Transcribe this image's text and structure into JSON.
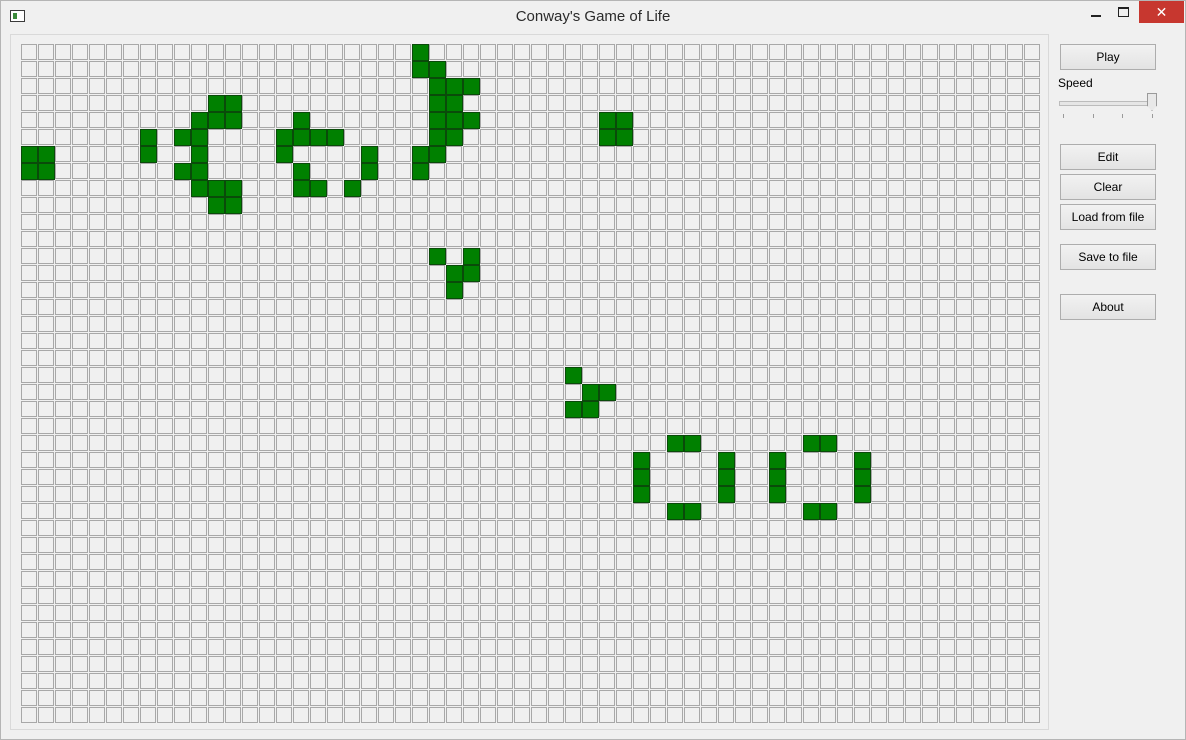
{
  "window": {
    "title": "Conway's Game of Life",
    "close_glyph": "✕"
  },
  "icons": {
    "app": "app-icon",
    "minimize": "minimize-icon",
    "maximize": "maximize-icon",
    "close": "close-icon"
  },
  "colors": {
    "alive": "#008000",
    "alive_border": "#0a4a0a",
    "dead": "#f0f0f0",
    "dead_border": "#a8a8a8"
  },
  "controls": {
    "play": "Play",
    "speed_label": "Speed",
    "speed_value": 1.0,
    "edit": "Edit",
    "clear": "Clear",
    "load": "Load from file",
    "save": "Save to file",
    "about": "About"
  },
  "board": {
    "cols": 60,
    "rows": 40,
    "alive": [
      [
        0,
        23
      ],
      [
        1,
        23
      ],
      [
        1,
        24
      ],
      [
        2,
        24
      ],
      [
        2,
        25
      ],
      [
        2,
        26
      ],
      [
        3,
        11
      ],
      [
        3,
        12
      ],
      [
        3,
        24
      ],
      [
        3,
        25
      ],
      [
        4,
        10
      ],
      [
        4,
        11
      ],
      [
        4,
        12
      ],
      [
        4,
        16
      ],
      [
        4,
        24
      ],
      [
        4,
        25
      ],
      [
        4,
        26
      ],
      [
        4,
        34
      ],
      [
        4,
        35
      ],
      [
        5,
        7
      ],
      [
        5,
        9
      ],
      [
        5,
        10
      ],
      [
        5,
        15
      ],
      [
        5,
        16
      ],
      [
        5,
        17
      ],
      [
        5,
        18
      ],
      [
        5,
        24
      ],
      [
        5,
        25
      ],
      [
        5,
        34
      ],
      [
        5,
        35
      ],
      [
        6,
        0
      ],
      [
        6,
        1
      ],
      [
        6,
        7
      ],
      [
        6,
        10
      ],
      [
        6,
        15
      ],
      [
        6,
        20
      ],
      [
        6,
        23
      ],
      [
        6,
        24
      ],
      [
        7,
        0
      ],
      [
        7,
        1
      ],
      [
        7,
        9
      ],
      [
        7,
        10
      ],
      [
        7,
        16
      ],
      [
        7,
        20
      ],
      [
        7,
        23
      ],
      [
        8,
        10
      ],
      [
        8,
        11
      ],
      [
        8,
        12
      ],
      [
        8,
        16
      ],
      [
        8,
        17
      ],
      [
        8,
        19
      ],
      [
        9,
        11
      ],
      [
        9,
        12
      ],
      [
        12,
        24
      ],
      [
        12,
        26
      ],
      [
        13,
        25
      ],
      [
        13,
        26
      ],
      [
        14,
        25
      ],
      [
        19,
        32
      ],
      [
        20,
        33
      ],
      [
        20,
        34
      ],
      [
        21,
        32
      ],
      [
        21,
        33
      ],
      [
        23,
        38
      ],
      [
        23,
        39
      ],
      [
        23,
        46
      ],
      [
        23,
        47
      ],
      [
        24,
        36
      ],
      [
        24,
        41
      ],
      [
        24,
        44
      ],
      [
        24,
        49
      ],
      [
        25,
        36
      ],
      [
        25,
        41
      ],
      [
        25,
        44
      ],
      [
        25,
        49
      ],
      [
        26,
        36
      ],
      [
        26,
        41
      ],
      [
        26,
        44
      ],
      [
        26,
        49
      ],
      [
        27,
        38
      ],
      [
        27,
        39
      ],
      [
        27,
        46
      ],
      [
        27,
        47
      ]
    ]
  }
}
